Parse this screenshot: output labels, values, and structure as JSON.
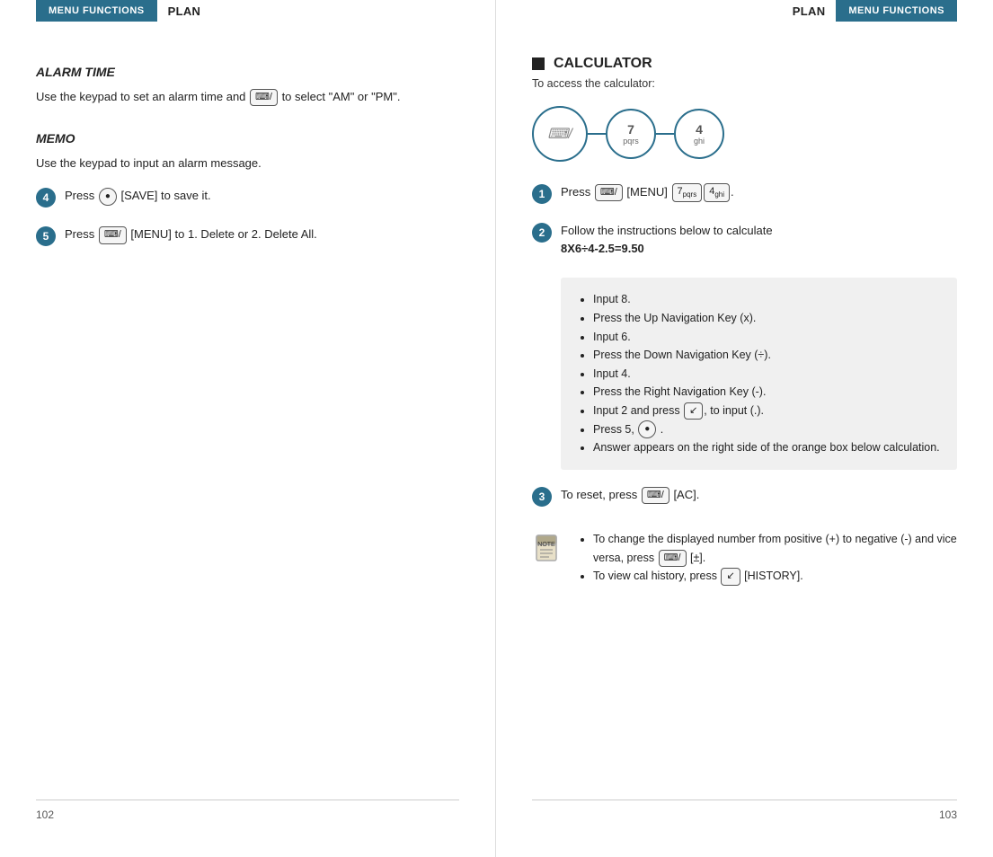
{
  "left": {
    "header": {
      "badge": "MENU FUNCTIONS",
      "plan": "PLAN"
    },
    "alarm_section": {
      "title": "ALARM TIME",
      "body": "Use the keypad to set an alarm time and",
      "body2": "to select \"AM\" or \"PM\"."
    },
    "memo_section": {
      "title": "MEMO",
      "body": "Use the keypad to input an alarm message."
    },
    "step4": {
      "number": "4",
      "text": "Press",
      "save_label": "[SAVE] to save it."
    },
    "step5": {
      "number": "5",
      "text": "Press",
      "menu_label": "[MENU] to 1. Delete or 2. Delete All."
    },
    "page_number": "102"
  },
  "right": {
    "header": {
      "plan": "PLAN",
      "badge": "MENU FUNCTIONS"
    },
    "calculator": {
      "heading": "CALCULATOR",
      "subtext": "To access the calculator:",
      "step1": {
        "number": "1",
        "text": "Press",
        "menu_label": "[MENU]"
      },
      "step2": {
        "number": "2",
        "text": "Follow the instructions below to calculate",
        "formula": "8X6÷4-2.5=9.50"
      },
      "bullets": [
        "Input 8.",
        "Press the Up Navigation Key (x).",
        "Input 6.",
        "Press the Down Navigation Key (÷).",
        "Input 4.",
        "Press the Right Navigation Key (-).",
        "Input 2 and press",
        "Press 5,",
        "Answer appears on the right side of the orange box below calculation."
      ],
      "step3": {
        "number": "3",
        "text": "To reset, press",
        "ac_label": "[AC]."
      },
      "notes": [
        "To change the displayed number from positive (+) to negative (-) and vice versa, press [±].",
        "To view cal history, press [HISTORY]."
      ]
    },
    "page_number": "103"
  }
}
